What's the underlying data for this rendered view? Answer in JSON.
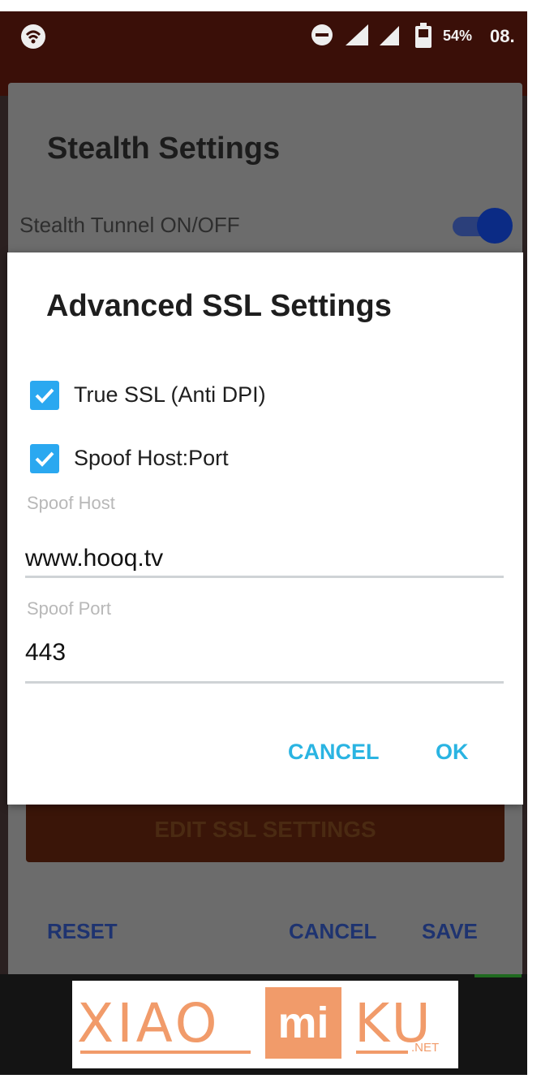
{
  "status_bar": {
    "left_icon": "wifi-lock-icon",
    "battery_percent": "54%",
    "time": "08."
  },
  "background_dialog": {
    "title": "Stealth Settings",
    "toggle_label": "Stealth Tunnel ON/OFF",
    "toggle_on": true,
    "edit_ssl_button": "EDIT SSL SETTINGS",
    "reset_button": "RESET",
    "cancel_button": "CANCEL",
    "save_button": "SAVE"
  },
  "ssl_dialog": {
    "title": "Advanced SSL Settings",
    "true_ssl": {
      "label": "True SSL (Anti DPI)",
      "checked": true
    },
    "spoof_host_port": {
      "label": "Spoof Host:Port",
      "checked": true
    },
    "spoof_host": {
      "label": "Spoof Host",
      "value": "www.hooq.tv"
    },
    "spoof_port": {
      "label": "Spoof Port",
      "value": "443"
    },
    "cancel_button": "CANCEL",
    "ok_button": "OK"
  },
  "watermark": {
    "text_left": "XIAO",
    "text_box": "mi",
    "text_right": "KU",
    "suffix": ".NET"
  },
  "colors": {
    "accent": "#2ab4e2",
    "checkbox": "#2aa8f0",
    "status_bar": "#3a0f08",
    "watermark": "#f19b6a"
  }
}
